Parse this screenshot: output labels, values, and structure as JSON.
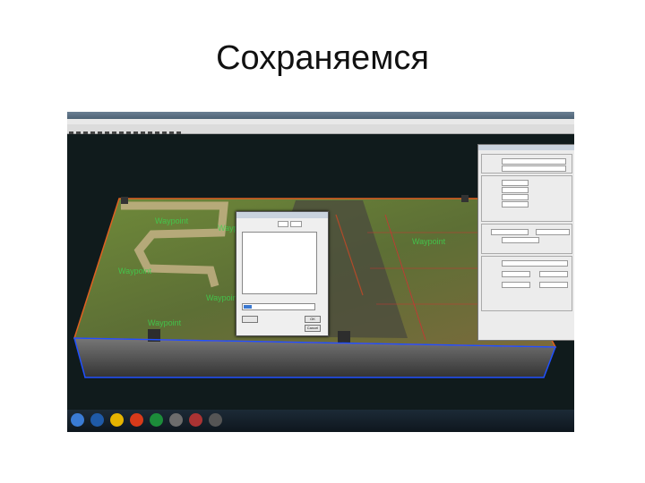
{
  "slide": {
    "title": "Сохраняемся"
  },
  "screenshot": {
    "waypoints": [
      "Waypoint",
      "Waypoint",
      "Waypoint",
      "Waypoint",
      "Waypoint",
      "Waypoint"
    ],
    "dialog": {
      "ok": "OK",
      "cancel": "Cancel"
    },
    "taskbar_icon_colors": [
      "#1f5aa8",
      "#e6b400",
      "#d83a1a",
      "#1c8c3a",
      "#6c6c6c",
      "#a33",
      "#555"
    ]
  }
}
